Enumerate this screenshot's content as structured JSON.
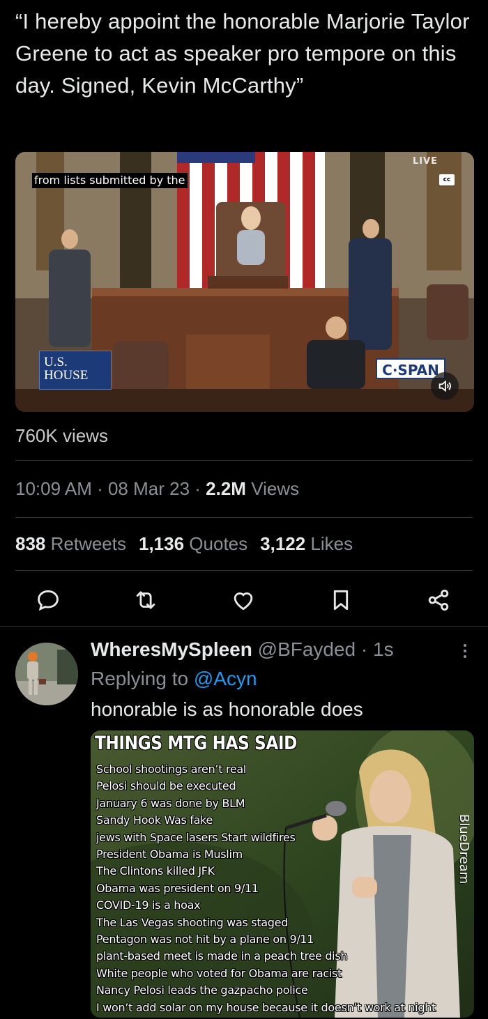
{
  "tweet": {
    "text": "“I hereby appoint the honorable Marjorie Taylor Greene to act as speaker pro tempore on this day. Signed, Kevin McCarthy”"
  },
  "video": {
    "caption": "from lists submitted by the",
    "live_label": "LIVE",
    "cc_label": "cc",
    "house_logo_line1": "U.S.",
    "house_logo_line2": "HOUSE",
    "network_logo": "C·SPAN",
    "volume_icon": "volume-icon"
  },
  "video_views": "760K views",
  "meta": {
    "time": "10:09 AM",
    "sep1": " · ",
    "date": "08 Mar 23",
    "sep2": " · ",
    "views_count": "2.2M",
    "views_label": " Views"
  },
  "stats": {
    "retweets_count": "838",
    "retweets_label": " Retweets",
    "quotes_count": "1,136",
    "quotes_label": " Quotes",
    "likes_count": "3,122",
    "likes_label": " Likes"
  },
  "actions": [
    "reply-icon",
    "retweet-icon",
    "like-icon",
    "bookmark-icon",
    "share-icon"
  ],
  "colors": {
    "background": "#000000",
    "text": "#e7e9ea",
    "secondary": "#8b9096",
    "link": "#1d9bf0",
    "divider": "#2f3336"
  },
  "reply": {
    "name": "WheresMySpleen",
    "handle": " @BFayded · 1s",
    "replying_prefix": "Replying to ",
    "replying_mention": "@Acyn",
    "text": "honorable is as honorable does",
    "meme": {
      "title": "THINGS MTG HAS SAID",
      "items": [
        "School shootings aren’t real",
        "Pelosi should be executed",
        "January 6 was done by BLM",
        "Sandy Hook Was fake",
        "jews with Space lasers Start wildfires",
        "President Obama is Muslim",
        "The Clintons killed JFK",
        "Obama was president on 9/11",
        "COVID-19 is a hoax",
        "The Las Vegas shooting was staged",
        "Pentagon was not hit by a plane on 9/11",
        "plant-based meet is made in a peach tree dish",
        "White people who voted for Obama are racist",
        "Nancy Pelosi leads the gazpacho police",
        "I won’t add solar on my house because it doesn’t work at night"
      ],
      "watermark": "BlueDream"
    }
  }
}
